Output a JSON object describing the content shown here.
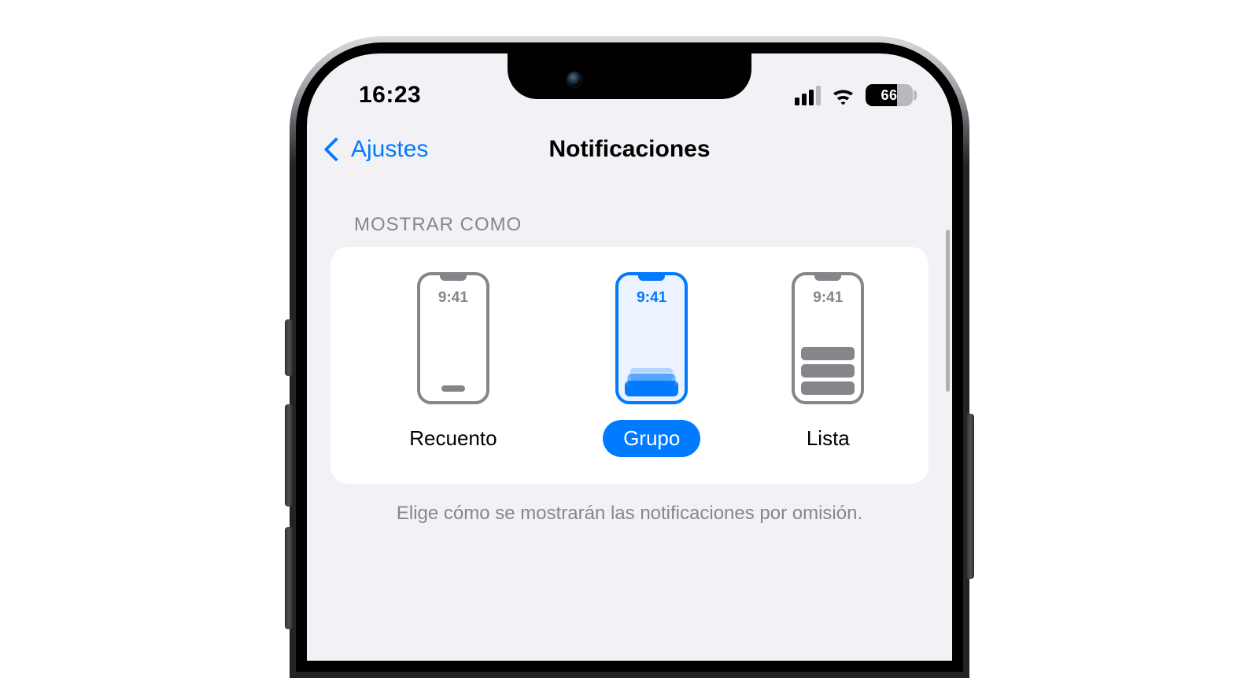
{
  "status": {
    "time": "16:23",
    "battery": "66"
  },
  "nav": {
    "back_label": "Ajustes",
    "title": "Notificaciones"
  },
  "section": {
    "header": "MOSTRAR COMO"
  },
  "options": {
    "mini_time": "9:41",
    "count": {
      "label": "Recuento",
      "selected": false
    },
    "stack": {
      "label": "Grupo",
      "selected": true
    },
    "list": {
      "label": "Lista",
      "selected": false
    }
  },
  "footer": "Elige cómo se mostrarán las notificaciones por omisión."
}
